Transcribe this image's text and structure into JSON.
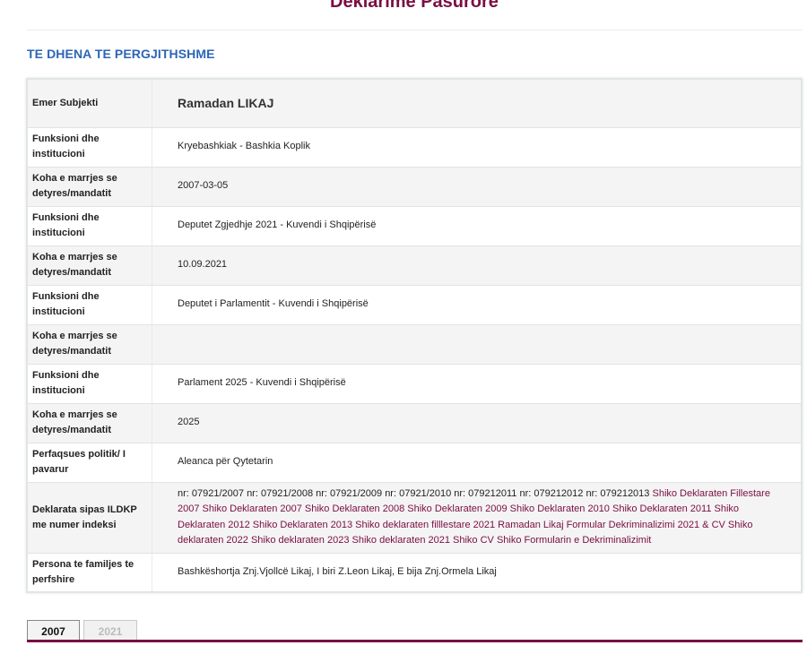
{
  "page_title": "Deklarime Pasurore",
  "section_title": "TE DHENA TE PERGJITHSHME",
  "rows": [
    {
      "label": "Emer Subjekti",
      "value": "Ramadan LIKAJ"
    },
    {
      "label": "Funksioni dhe institucioni",
      "value": "Kryebashkiak - Bashkia Koplik"
    },
    {
      "label": "Koha e marrjes se detyres/mandatit",
      "value": "2007-03-05"
    },
    {
      "label": "Funksioni dhe institucioni",
      "value": "Deputet Zgjedhje 2021 - Kuvendi i Shqipërisë"
    },
    {
      "label": "Koha e marrjes se detyres/mandatit",
      "value": "10.09.2021"
    },
    {
      "label": "Funksioni dhe institucioni",
      "value": "Deputet i Parlamentit - Kuvendi i Shqipërisë"
    },
    {
      "label": "Koha e marrjes se detyres/mandatit",
      "value": ""
    },
    {
      "label": "Funksioni dhe institucioni",
      "value": "Parlament 2025 - Kuvendi i Shqipërisë"
    },
    {
      "label": "Koha e marrjes se detyres/mandatit",
      "value": "2025"
    },
    {
      "label": "Perfaqsues politik/ I pavarur",
      "value": "Aleanca për Qytetarin"
    },
    {
      "label": "Deklarata sipas ILDKP me numer indeksi",
      "value": ""
    },
    {
      "label": "Persona te familjes te perfshire",
      "value": "Bashkëshortja Znj.Vjollcë Likaj, I biri Z.Leon Likaj, E bija Znj.Ormela Likaj"
    }
  ],
  "declarations": {
    "index_text": "nr: 07921/2007 nr: 07921/2008 nr: 07921/2009 nr: 07921/2010 nr: 079212011 nr: 079212012 nr: 079212013",
    "links": [
      "Shiko Deklaraten Fillestare 2007",
      "Shiko Deklaraten 2007",
      "Shiko Deklaraten 2008",
      "Shiko Deklaraten 2009",
      "Shiko Deklaraten 2010",
      "Shiko Deklaraten 2011",
      "Shiko Deklaraten 2012",
      "Shiko Deklaraten 2013",
      "Shiko deklaraten filllestare 2021",
      "Ramadan Likaj Formular Dekriminalizimi 2021 & CV",
      "Shiko deklaraten 2022",
      "Shiko deklaraten 2023",
      "Shiko deklaraten 2021",
      "Shiko CV",
      "Shiko Formularin e Dekriminalizimit"
    ]
  },
  "tabs": [
    {
      "label": "2007",
      "active": true
    },
    {
      "label": "2021",
      "active": false
    }
  ],
  "colors": {
    "accent": "#7a0e43",
    "section_blue": "#2b66b5"
  }
}
